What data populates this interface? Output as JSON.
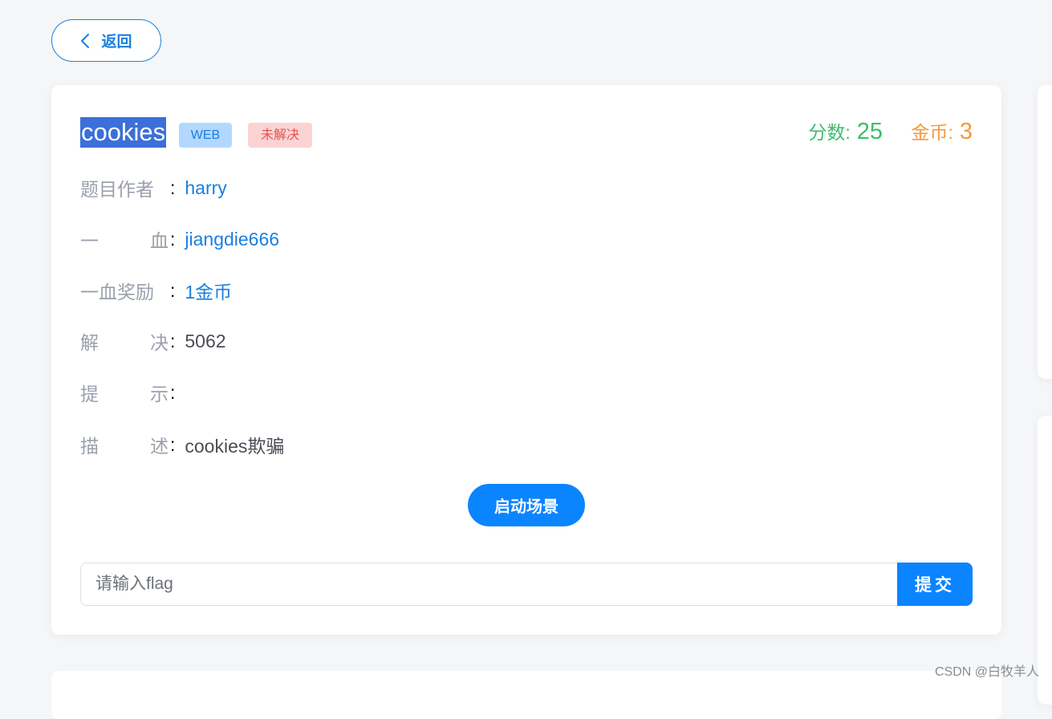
{
  "back_button": {
    "label": "返回",
    "icon": "chevron-left-icon"
  },
  "challenge": {
    "title": "cookies",
    "category": "WEB",
    "status": "未解决",
    "score": {
      "label": "分数:",
      "value": "25"
    },
    "coins": {
      "label": "金币:",
      "value": "3"
    },
    "info": {
      "author": {
        "label_chars": [
          "题目作者"
        ],
        "value": "harry"
      },
      "first_blood": {
        "label_chars": [
          "一",
          "血"
        ],
        "value": "jiangdie666"
      },
      "first_blood_reward": {
        "label_chars": [
          "一血奖励"
        ],
        "value": "1金币"
      },
      "solves": {
        "label_chars": [
          "解",
          "决"
        ],
        "value": "5062"
      },
      "hint": {
        "label_chars": [
          "提",
          "示"
        ],
        "value": ""
      },
      "description": {
        "label_chars": [
          "描",
          "述"
        ],
        "value": "cookies欺骗"
      }
    },
    "colon": ":",
    "start_button": "启动场景",
    "flag_input": {
      "placeholder": "请输入flag",
      "value": ""
    },
    "submit_button": "提交"
  },
  "watermark": "CSDN @白牧羊人",
  "colors": {
    "primary": "#0a84ff",
    "link": "#1a7fe0",
    "score": "#3dbd6b",
    "coins": "#f59a3c",
    "badge_web_bg": "#b3d8ff",
    "badge_status_bg": "#fcd3d3",
    "badge_status_text": "#e25555",
    "title_highlight": "#3c6fd9"
  }
}
